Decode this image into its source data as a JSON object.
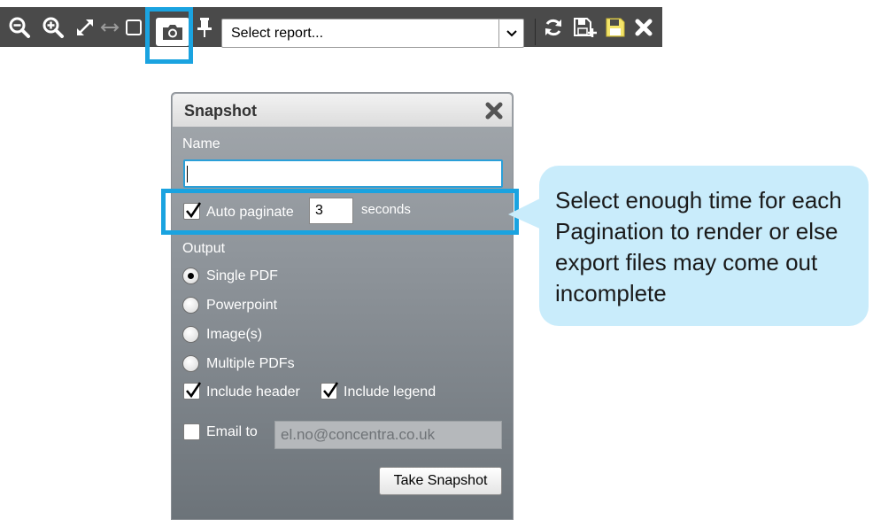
{
  "toolbar": {
    "icons": [
      "zoom-out-icon",
      "zoom-in-icon",
      "expand-icon",
      "fit-width-icon",
      "fit-page-icon",
      "camera-icon",
      "pin-icon",
      "refresh-icon",
      "save-as-icon",
      "save-icon",
      "close-icon"
    ],
    "report_select_placeholder": "Select report...",
    "accent_color": "#1aa3e0"
  },
  "snapshot": {
    "title": "Snapshot",
    "name_label": "Name",
    "name_value": "",
    "auto_paginate_label": "Auto paginate",
    "auto_paginate_checked": true,
    "paginate_seconds": "3",
    "seconds_label": "seconds",
    "output_label": "Output",
    "output_options": [
      "Single PDF",
      "Powerpoint",
      "Image(s)",
      "Multiple PDFs"
    ],
    "output_selected": "Single PDF",
    "include_header_label": "Include header",
    "include_header_checked": true,
    "include_legend_label": "Include legend",
    "include_legend_checked": true,
    "email_to_label": "Email to",
    "email_to_checked": false,
    "email_value": "el.no@concentra.co.uk",
    "take_snapshot_label": "Take Snapshot"
  },
  "callout": {
    "text": "Select enough time for each Pagination to render or else export files may come out incomplete",
    "background": "#c9ecfb"
  }
}
